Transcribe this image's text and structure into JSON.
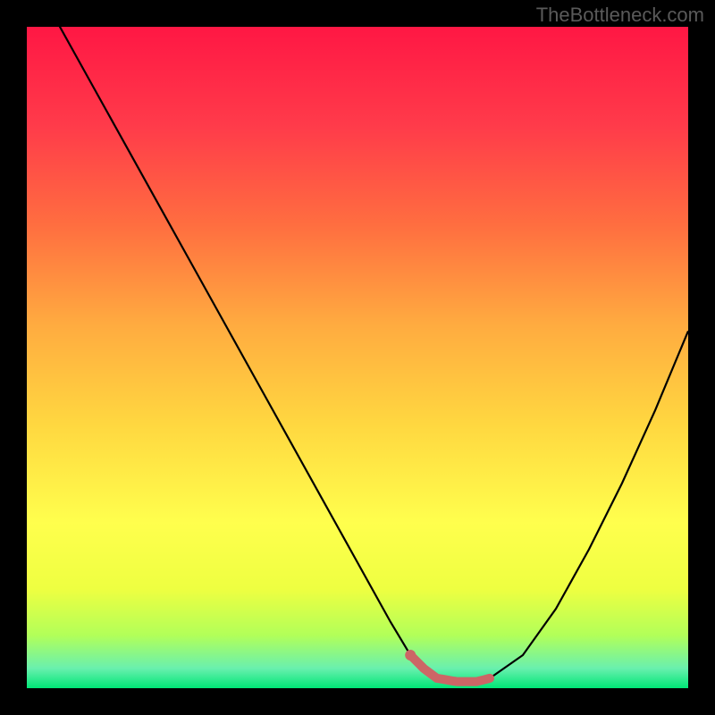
{
  "watermark": "TheBottleneck.com",
  "chart_data": {
    "type": "line",
    "title": "",
    "xlabel": "",
    "ylabel": "",
    "xlim": [
      0,
      100
    ],
    "ylim": [
      0,
      100
    ],
    "series": [
      {
        "name": "bottleneck-curve",
        "x": [
          0,
          5,
          10,
          15,
          20,
          25,
          30,
          35,
          40,
          45,
          50,
          55,
          58,
          60,
          62,
          65,
          68,
          70,
          75,
          80,
          85,
          90,
          95,
          100
        ],
        "y": [
          108,
          100,
          91,
          82,
          73,
          64,
          55,
          46,
          37,
          28,
          19,
          10,
          5,
          3,
          1.5,
          1,
          1,
          1.5,
          5,
          12,
          21,
          31,
          42,
          54
        ]
      }
    ],
    "highlight": {
      "name": "optimal-range",
      "x_start": 58,
      "x_end": 70,
      "y": 1,
      "color": "#cc6666"
    },
    "gradient_stops": [
      {
        "offset": 0,
        "color": "#ff1744"
      },
      {
        "offset": 15,
        "color": "#ff3b4a"
      },
      {
        "offset": 30,
        "color": "#ff6e40"
      },
      {
        "offset": 45,
        "color": "#ffab40"
      },
      {
        "offset": 60,
        "color": "#ffd740"
      },
      {
        "offset": 75,
        "color": "#ffff4d"
      },
      {
        "offset": 85,
        "color": "#eeff41"
      },
      {
        "offset": 92,
        "color": "#b2ff59"
      },
      {
        "offset": 97,
        "color": "#69f0ae"
      },
      {
        "offset": 100,
        "color": "#00e676"
      }
    ]
  }
}
